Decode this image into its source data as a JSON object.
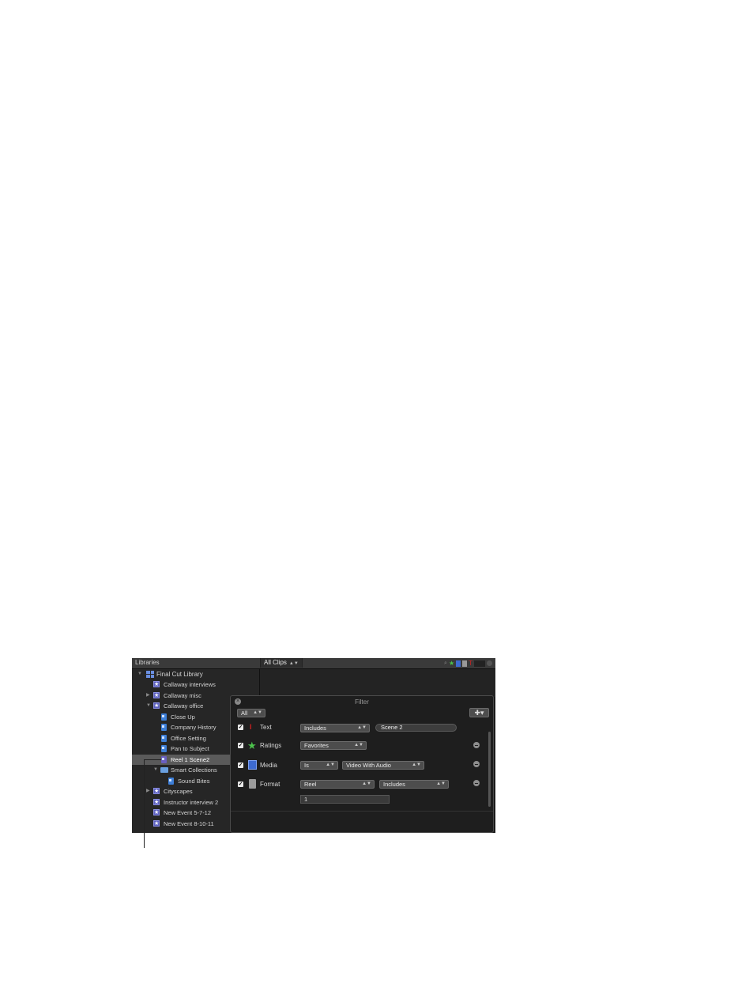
{
  "topbar": {
    "libraries": "Libraries",
    "clips_filter": "All Clips"
  },
  "sidebar": {
    "library": "Final Cut Library",
    "items": [
      {
        "label": "Callaway interviews"
      },
      {
        "label": "Callaway misc"
      },
      {
        "label": "Callaway office"
      },
      {
        "label": "Close Up"
      },
      {
        "label": "Company History"
      },
      {
        "label": "Office Setting"
      },
      {
        "label": "Pan to Subject"
      },
      {
        "label": "Reel 1 Scene2"
      },
      {
        "label": "Smart Collections"
      },
      {
        "label": "Sound Bites"
      },
      {
        "label": "Cityscapes"
      },
      {
        "label": "Instructor interview 2"
      },
      {
        "label": "New Event 5-7-12"
      },
      {
        "label": "New Event 8-10-11"
      }
    ]
  },
  "filter": {
    "title": "Filter",
    "match": "All",
    "rules": {
      "text": {
        "label": "Text",
        "op": "Includes",
        "value": "Scene 2"
      },
      "ratings": {
        "label": "Ratings",
        "op": "Favorites"
      },
      "media": {
        "label": "Media",
        "op": "Is",
        "value": "Video With Audio"
      },
      "format": {
        "label": "Format",
        "op": "Reel",
        "op2": "Includes",
        "value": "1"
      }
    }
  },
  "colors": {
    "accent_green": "#4cc24c",
    "event_purple": "#5b5fc0",
    "keyword_blue": "#3d7fd8"
  }
}
